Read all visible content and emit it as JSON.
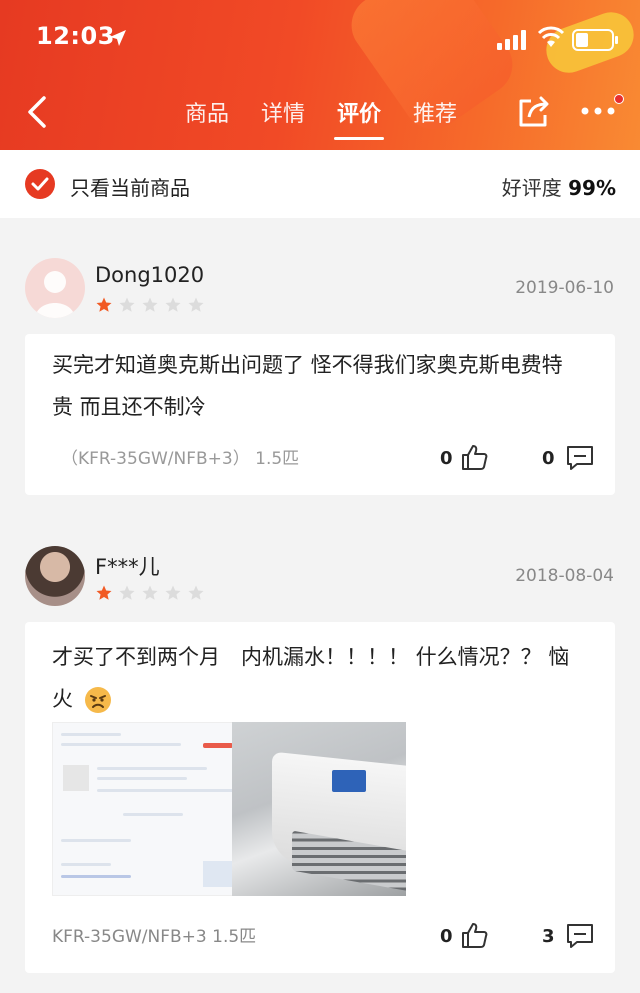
{
  "status_bar": {
    "time": "12:03"
  },
  "nav": {
    "tabs": [
      {
        "label": "商品"
      },
      {
        "label": "详情"
      },
      {
        "label": "评价"
      },
      {
        "label": "推荐"
      }
    ],
    "active_tab": "评价"
  },
  "filter": {
    "label": "只看当前商品",
    "rating_label": "好评度",
    "rating_value": "99%"
  },
  "reviews": [
    {
      "username": "Dong1020",
      "stars_filled": 1,
      "stars_total": 5,
      "date": "2019-06-10",
      "text": "买完才知道奥克斯出问题了 怪不得我们家奥克斯电费特贵 而且还不制冷",
      "spec": "（KFR-35GW/NFB+3） 1.5匹",
      "likes": "0",
      "comments": "0"
    },
    {
      "username": "F***儿",
      "stars_filled": 1,
      "stars_total": 5,
      "date": "2018-08-04",
      "text": "才买了不到两个月　内机漏水！！！！ 什么情况？？ 恼火",
      "spec": "KFR-35GW/NFB+3 1.5匹",
      "likes": "0",
      "comments": "3"
    }
  ],
  "colors": {
    "brand_red": "#e63a22",
    "star_active": "#f15a24",
    "star_inactive": "#dcdcdc"
  }
}
